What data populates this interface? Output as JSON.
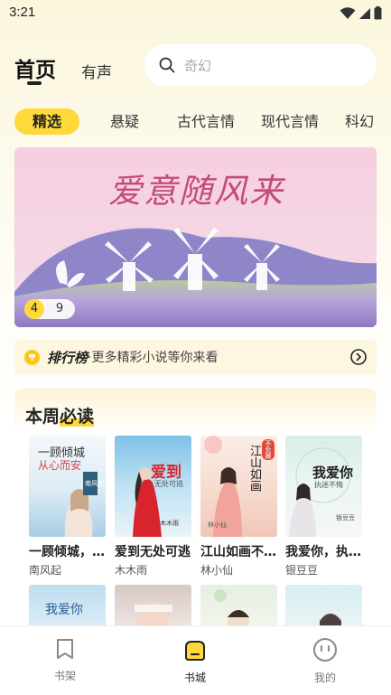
{
  "status_bar": {
    "time": "3:21"
  },
  "header": {
    "tabs": [
      {
        "label": "首页",
        "active": true
      },
      {
        "label": "有声",
        "active": false
      }
    ],
    "search": {
      "placeholder": "奇幻"
    }
  },
  "categories": [
    {
      "label": "精选",
      "active": true
    },
    {
      "label": "悬疑"
    },
    {
      "label": "古代言情"
    },
    {
      "label": "现代言情"
    },
    {
      "label": "科幻"
    }
  ],
  "banner": {
    "title": "爱意随风来",
    "pager_current": "4",
    "pager_total": "9"
  },
  "ranking": {
    "title": "排行榜",
    "subtitle": "·更多精彩小说等你来看"
  },
  "weekly": {
    "title_prefix": "本周",
    "title_accent": "必读",
    "books": [
      {
        "title": "一顾倾城，从心而安",
        "author": "南风起",
        "cover_text": "一顾倾城",
        "cover_text2": "从心而安",
        "cover_badge": "南风起"
      },
      {
        "title": "爱到无处可逃",
        "author": "木木雨",
        "cover_text": "爱到",
        "cover_text2": "无处可逃",
        "cover_badge": "木木雨"
      },
      {
        "title": "江山如画不负卿",
        "author": "林小仙",
        "cover_text": "江山如画",
        "cover_text2": "不负卿",
        "cover_badge": "林小仙"
      },
      {
        "title": "我爱你，执迷不悔",
        "author": "银豆豆",
        "cover_text": "我爱你",
        "cover_text2": "执迷不悔",
        "cover_badge": "银豆豆"
      }
    ]
  },
  "bottom_nav": [
    {
      "label": "书架",
      "icon": "bookmark-icon",
      "active": false
    },
    {
      "label": "书城",
      "icon": "store-icon",
      "active": true
    },
    {
      "label": "我的",
      "icon": "profile-icon",
      "active": false
    }
  ],
  "colors": {
    "accent": "#ffd83a",
    "banner_title": "#c34b78"
  }
}
